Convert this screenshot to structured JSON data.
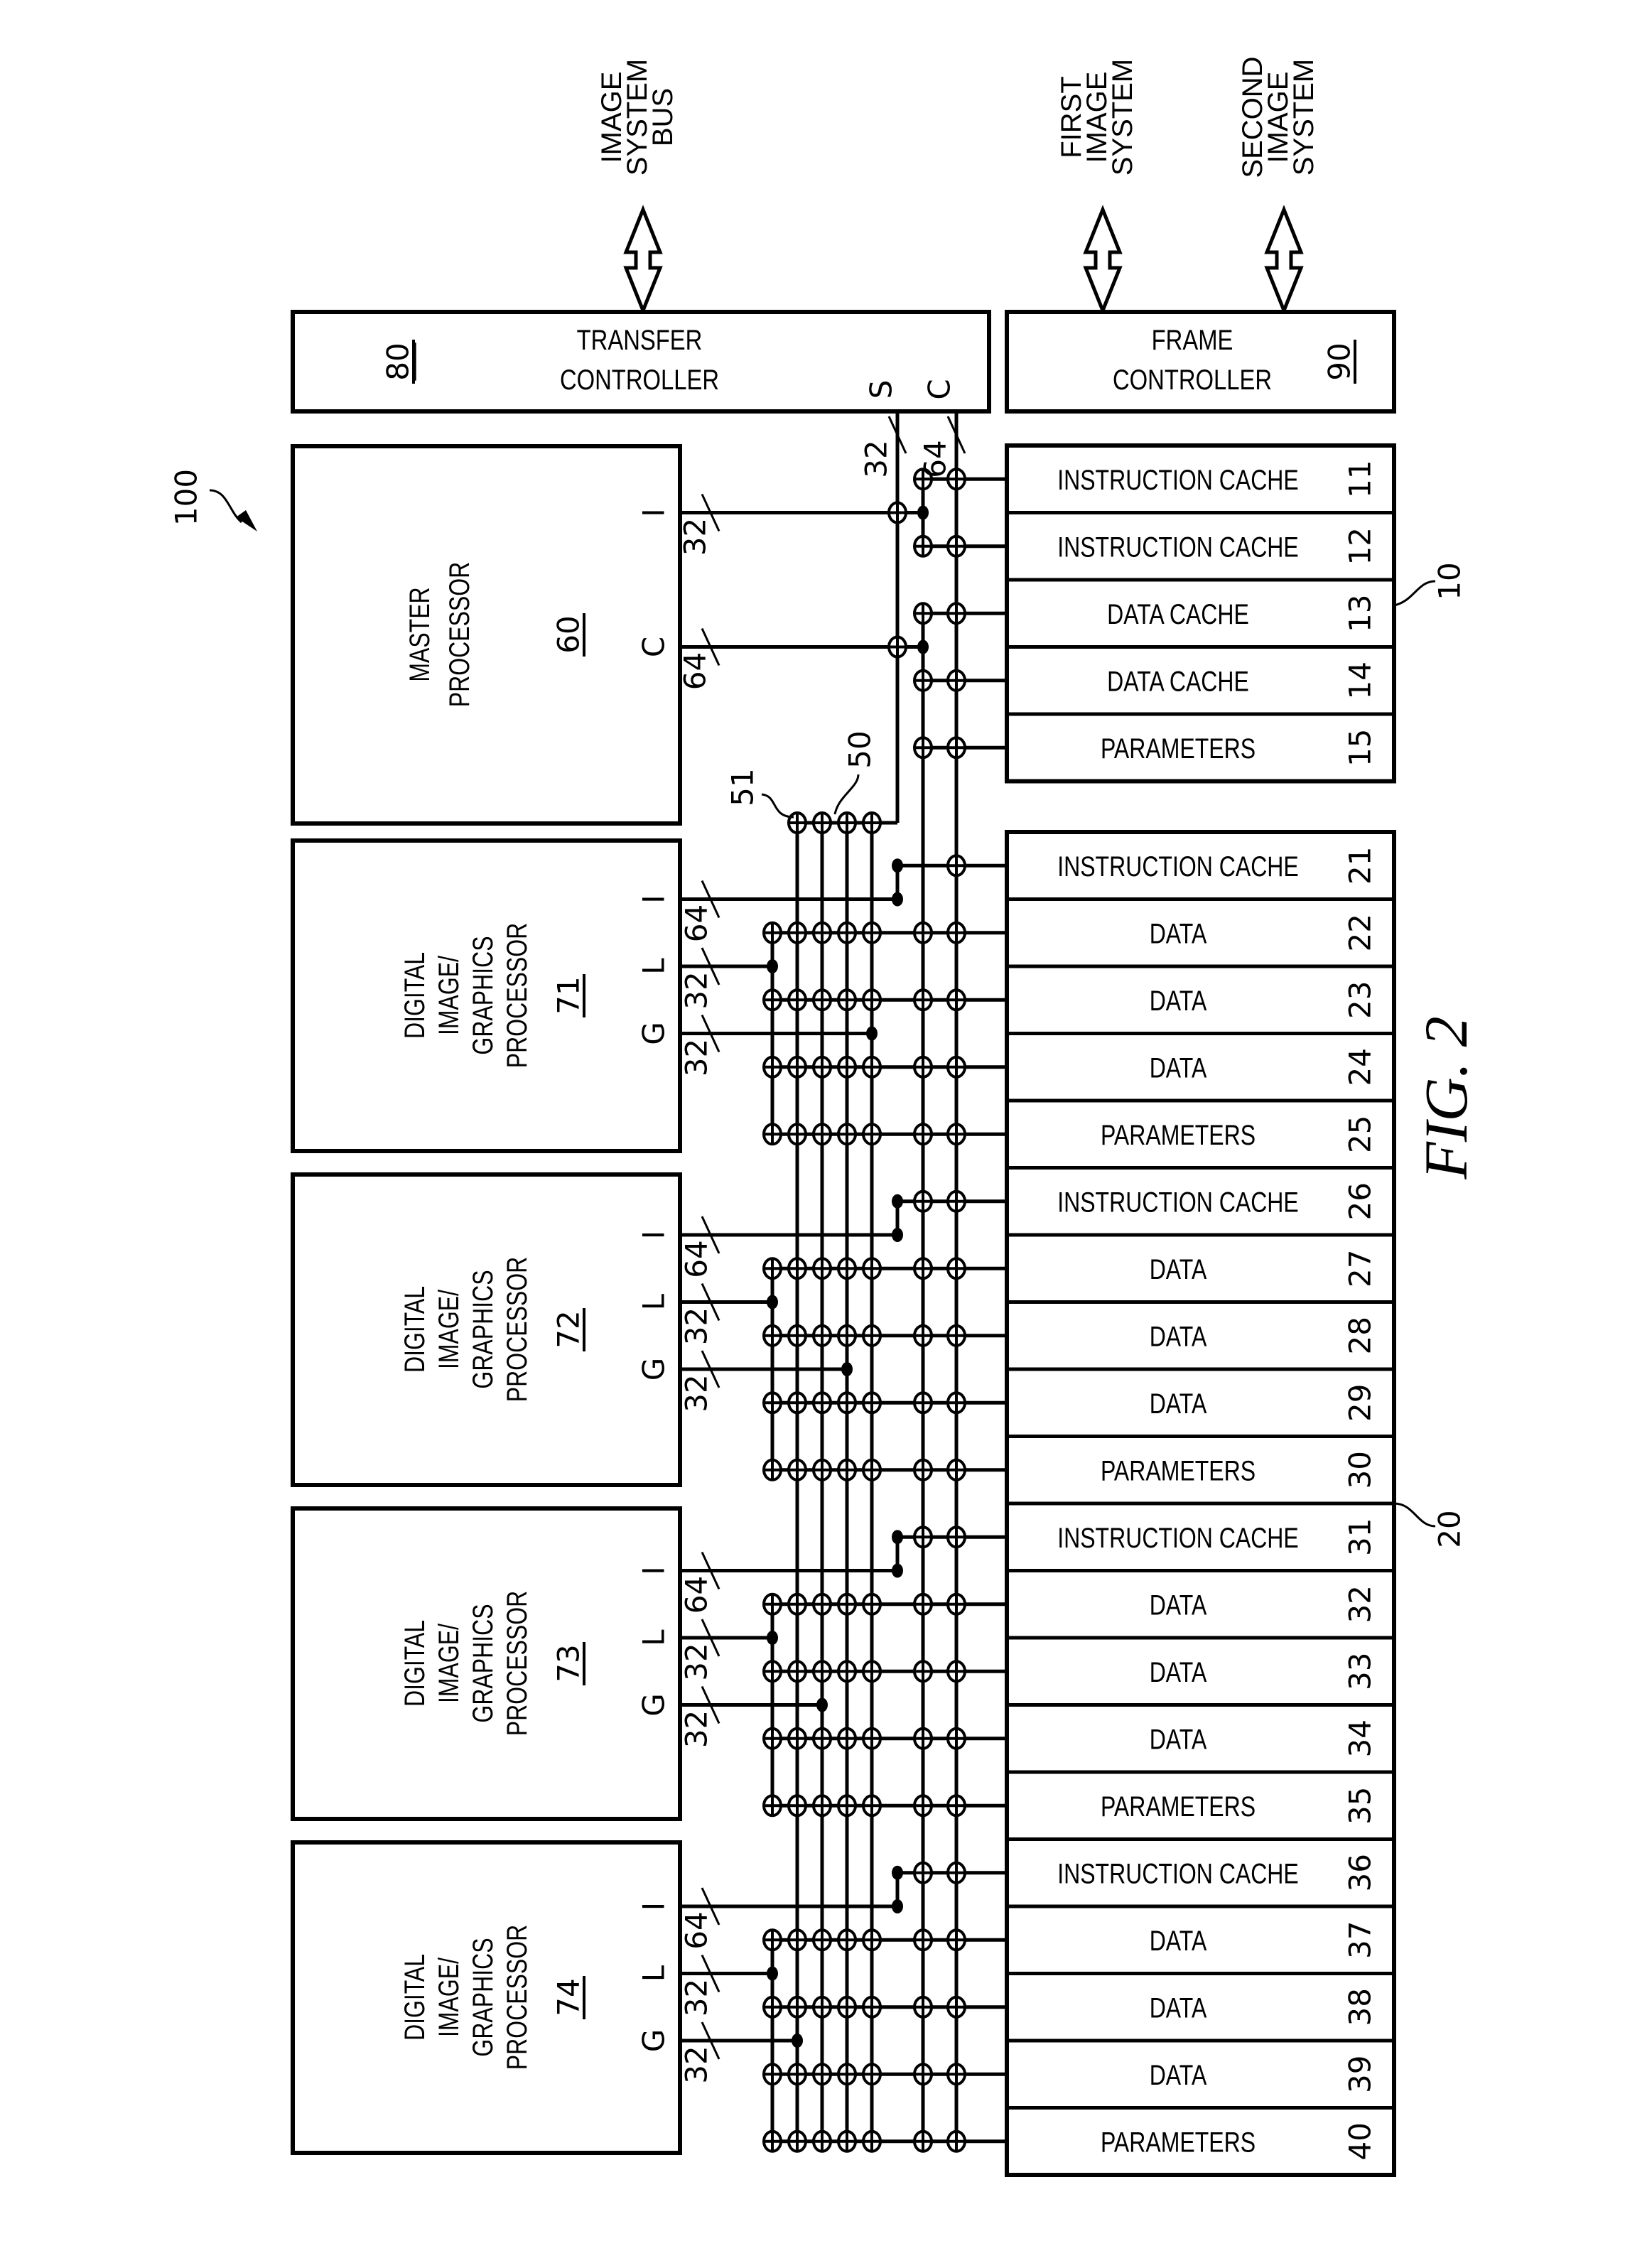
{
  "figure": {
    "title": "FIG. 2",
    "system_ref": "100"
  },
  "external_links": [
    {
      "id": "image-system-bus",
      "label_lines": [
        "IMAGE",
        "SYSTEM",
        "BUS"
      ]
    },
    {
      "id": "first-image-system",
      "label_lines": [
        "FIRST",
        "IMAGE",
        "SYSTEM"
      ]
    },
    {
      "id": "second-image-system",
      "label_lines": [
        "SECOND",
        "IMAGE",
        "SYSTEM"
      ]
    }
  ],
  "transfer_controller": {
    "ref": "80",
    "label_lines": [
      "TRANSFER",
      "CONTROLLER"
    ],
    "ports": {
      "s": "S",
      "c": "C"
    },
    "widths": {
      "s": "32",
      "c": "64"
    }
  },
  "frame_controller": {
    "ref": "90",
    "label_lines": [
      "FRAME",
      "CONTROLLER"
    ]
  },
  "master_processor": {
    "ref": "60",
    "label_lines": [
      "MASTER",
      "PROCESSOR"
    ],
    "ports": [
      {
        "name": "I",
        "width": "32"
      },
      {
        "name": "C",
        "width": "64"
      }
    ]
  },
  "digital_processors": [
    {
      "ref": "71",
      "label_lines": [
        "DIGITAL",
        "IMAGE/",
        "GRAPHICS",
        "PROCESSOR"
      ],
      "ports": [
        {
          "name": "I",
          "width": "64"
        },
        {
          "name": "L",
          "width": "32"
        },
        {
          "name": "G",
          "width": "32"
        }
      ],
      "global_bus_column": 4
    },
    {
      "ref": "72",
      "label_lines": [
        "DIGITAL",
        "IMAGE/",
        "GRAPHICS",
        "PROCESSOR"
      ],
      "ports": [
        {
          "name": "I",
          "width": "64"
        },
        {
          "name": "L",
          "width": "32"
        },
        {
          "name": "G",
          "width": "32"
        }
      ],
      "global_bus_column": 3
    },
    {
      "ref": "73",
      "label_lines": [
        "DIGITAL",
        "IMAGE/",
        "GRAPHICS",
        "PROCESSOR"
      ],
      "ports": [
        {
          "name": "I",
          "width": "64"
        },
        {
          "name": "L",
          "width": "32"
        },
        {
          "name": "G",
          "width": "32"
        }
      ],
      "global_bus_column": 2
    },
    {
      "ref": "74",
      "label_lines": [
        "DIGITAL",
        "IMAGE/",
        "GRAPHICS",
        "PROCESSOR"
      ],
      "ports": [
        {
          "name": "I",
          "width": "64"
        },
        {
          "name": "L",
          "width": "32"
        },
        {
          "name": "G",
          "width": "32"
        }
      ],
      "global_bus_column": 1
    }
  ],
  "crossbar": {
    "ref": "50",
    "crosspoint_ref": "51"
  },
  "memory_groups": [
    {
      "ref": "10",
      "rows": [
        {
          "label": "INSTRUCTION  CACHE",
          "ref": "11"
        },
        {
          "label": "INSTRUCTION  CACHE",
          "ref": "12"
        },
        {
          "label": "DATA  CACHE",
          "ref": "13"
        },
        {
          "label": "DATA  CACHE",
          "ref": "14"
        },
        {
          "label": "PARAMETERS",
          "ref": "15"
        }
      ]
    },
    {
      "ref": "20",
      "rows": [
        {
          "label": "INSTRUCTION  CACHE",
          "ref": "21"
        },
        {
          "label": "DATA",
          "ref": "22"
        },
        {
          "label": "DATA",
          "ref": "23"
        },
        {
          "label": "DATA",
          "ref": "24"
        },
        {
          "label": "PARAMETERS",
          "ref": "25"
        },
        {
          "label": "INSTRUCTION  CACHE",
          "ref": "26"
        },
        {
          "label": "DATA",
          "ref": "27"
        },
        {
          "label": "DATA",
          "ref": "28"
        },
        {
          "label": "DATA",
          "ref": "29"
        },
        {
          "label": "PARAMETERS",
          "ref": "30"
        },
        {
          "label": "INSTRUCTION  CACHE",
          "ref": "31"
        },
        {
          "label": "DATA",
          "ref": "32"
        },
        {
          "label": "DATA",
          "ref": "33"
        },
        {
          "label": "DATA",
          "ref": "34"
        },
        {
          "label": "PARAMETERS",
          "ref": "35"
        },
        {
          "label": "INSTRUCTION  CACHE",
          "ref": "36"
        },
        {
          "label": "DATA",
          "ref": "37"
        },
        {
          "label": "DATA",
          "ref": "38"
        },
        {
          "label": "DATA",
          "ref": "39"
        },
        {
          "label": "PARAMETERS",
          "ref": "40"
        }
      ]
    }
  ]
}
